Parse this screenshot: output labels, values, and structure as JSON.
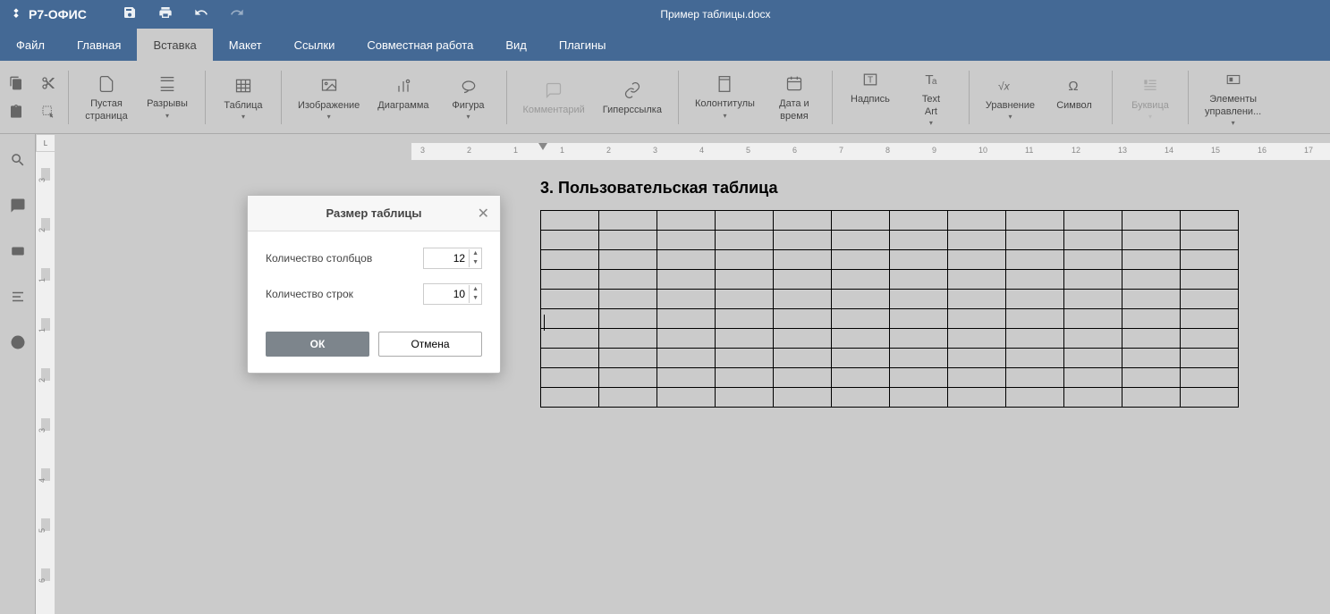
{
  "app": {
    "name": "Р7-ОФИС",
    "document_title": "Пример таблицы.docx"
  },
  "menu": {
    "file": "Файл",
    "home": "Главная",
    "insert": "Вставка",
    "layout": "Макет",
    "links": "Ссылки",
    "collab": "Совместная работа",
    "view": "Вид",
    "plugins": "Плагины"
  },
  "ribbon": {
    "blank_page": "Пустая\nстраница",
    "breaks": "Разрывы",
    "table": "Таблица",
    "image": "Изображение",
    "chart": "Диаграмма",
    "shape": "Фигура",
    "comment": "Комментарий",
    "hyperlink": "Гиперссылка",
    "headers": "Колонтитулы",
    "datetime": "Дата и\nвремя",
    "textbox": "Надпись",
    "textart": "Text\nArt",
    "equation": "Уравнение",
    "symbol": "Символ",
    "dropcap": "Буквица",
    "controls": "Элементы\nуправлени..."
  },
  "document": {
    "heading": "3. Пользовательская таблица",
    "table_cols": 12,
    "table_rows": 10
  },
  "dialog": {
    "title": "Размер таблицы",
    "cols_label": "Количество столбцов",
    "rows_label": "Количество строк",
    "cols_value": "12",
    "rows_value": "10",
    "ok": "ОК",
    "cancel": "Отмена"
  },
  "ruler_h": [
    "3",
    "2",
    "1",
    "1",
    "2",
    "3",
    "4",
    "5",
    "6",
    "7",
    "8",
    "9",
    "10",
    "11",
    "12",
    "13",
    "14",
    "15",
    "16",
    "17"
  ],
  "ruler_v": [
    "3",
    "2",
    "1",
    "1",
    "2",
    "3",
    "4",
    "5",
    "6"
  ]
}
